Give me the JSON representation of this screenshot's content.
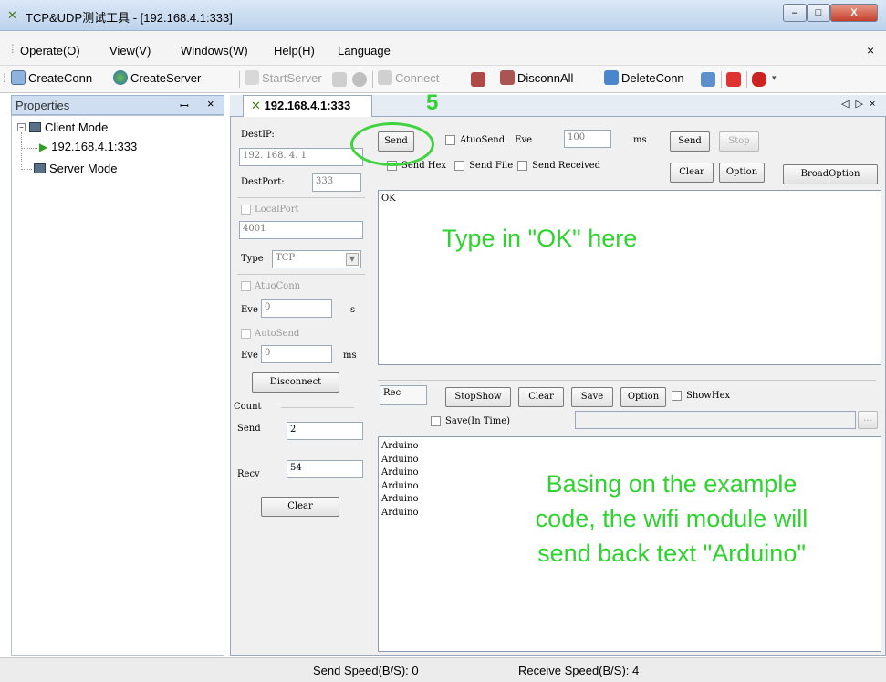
{
  "window": {
    "title": "TCP&UDP测试工具 - [192.168.4.1:333]",
    "app_icon": "app-logo-icon",
    "min_glyph": "–",
    "max_glyph": "□",
    "close_glyph": "X"
  },
  "menu": {
    "operate": "Operate(O)",
    "view": "View(V)",
    "windows": "Windows(W)",
    "help": "Help(H)",
    "language": "Language",
    "close_glyph": "×"
  },
  "toolbar": {
    "create_conn": "CreateConn",
    "create_server": "CreateServer",
    "start_server": "StartServer",
    "connect": "Connect",
    "disconn_all": "DisconnAll",
    "delete_conn": "DeleteConn"
  },
  "properties": {
    "title": "Properties",
    "pin_glyph": "ꟷ",
    "close_glyph": "×",
    "tree": {
      "client_mode": "Client Mode",
      "client_item": "192.168.4.1:333",
      "server_mode": "Server Mode"
    }
  },
  "tab": {
    "label": "192.168.4.1:333",
    "nav": "◁ ▷ ×"
  },
  "settings": {
    "dest_ip_label": "DestIP:",
    "dest_ip_value": "192. 168. 4. 1",
    "dest_port_label": "DestPort:",
    "dest_port_value": "333",
    "local_port_label": "LocalPort",
    "local_port_value": "4001",
    "type_label": "Type",
    "type_value": "TCP",
    "auto_conn_label": "AtuoConn",
    "eve_label": "Eve",
    "auto_conn_eve_value": "0",
    "auto_conn_unit": "s",
    "auto_send_label": "AutoSend",
    "auto_send_eve_value": "0",
    "auto_send_unit": "ms",
    "disconnect_label": "Disconnect",
    "count_label": "Count",
    "send_label": "Send",
    "send_count": "2",
    "recv_label": "Recv",
    "recv_count": "54",
    "clear_label": "Clear"
  },
  "send_panel": {
    "send_button": "Send",
    "auto_send_label": "AtuoSend",
    "eve_label": "Eve",
    "eve_value": "100",
    "unit": "ms",
    "send_button2": "Send",
    "stop_button": "Stop",
    "send_hex_label": "Send Hex",
    "send_file_label": "Send File",
    "send_received_label": "Send Received",
    "clear_button": "Clear",
    "option_button": "Option",
    "broad_option_button": "BroadOption",
    "text": "OK"
  },
  "recv_panel": {
    "rec_label": "Rec",
    "stop_show": "StopShow",
    "clear": "Clear",
    "save": "Save",
    "option": "Option",
    "show_hex": "ShowHex",
    "save_in_time": "Save(In Time)",
    "browse": "...",
    "lines": [
      "Arduino",
      "Arduino",
      "Arduino",
      "Arduino",
      "Arduino",
      "Arduino"
    ]
  },
  "annotations": {
    "step_number": "5",
    "type_hint": "Type in \"OK\" here",
    "response_hint_1": "Basing  on the  example",
    "response_hint_2": "code, the wifi module will",
    "response_hint_3": "send back text \"Arduino\"",
    "color": "#2fd32f"
  },
  "status": {
    "send_speed": "Send Speed(B/S): 0",
    "receive_speed": "Receive Speed(B/S): 4"
  }
}
